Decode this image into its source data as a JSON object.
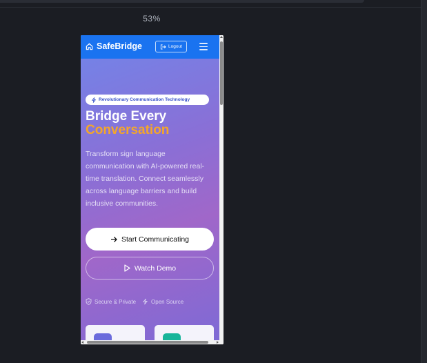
{
  "browser": {
    "zoom": "53%"
  },
  "navbar": {
    "brand": "SafeBridge",
    "logout_label": "Logout"
  },
  "hero": {
    "badge": "Revolutionary Communication Technology",
    "title_line1": "Bridge Every",
    "title_line2": "Conversation",
    "description": "Transform sign language communication with AI-powered real-time translation. Connect seamlessly across language barriers and build inclusive communities.",
    "primary_cta": "Start Communicating",
    "secondary_cta": "Watch Demo",
    "features": [
      {
        "label": "Secure & Private",
        "icon": "shield-icon"
      },
      {
        "label": "Open Source",
        "icon": "bolt-icon"
      }
    ]
  },
  "colors": {
    "nav": "#1a73f0",
    "accent": "#f4a62a",
    "card1_icon": "#6b6bdc",
    "card2_icon": "#18b59a"
  }
}
